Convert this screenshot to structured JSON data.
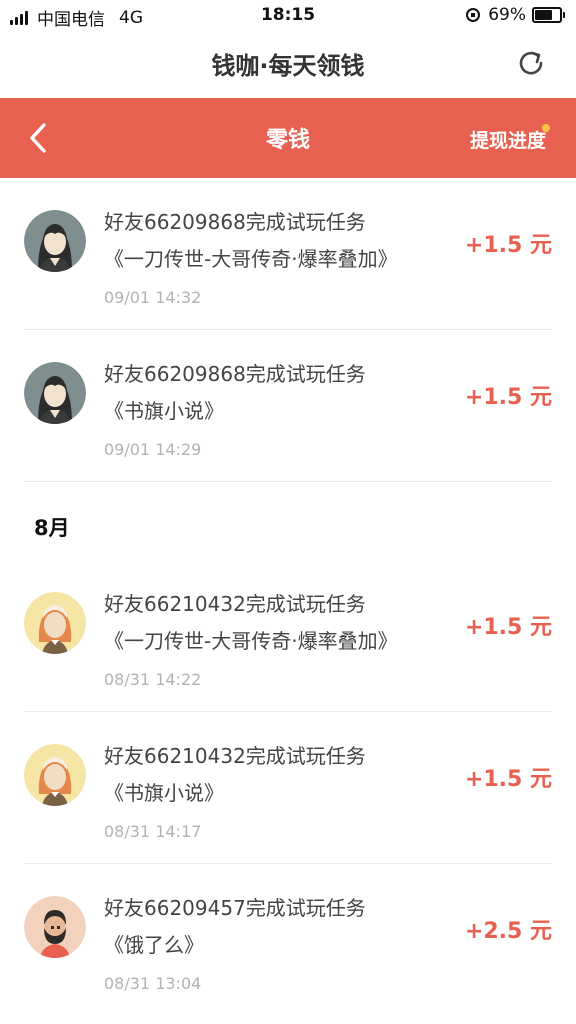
{
  "status_bar": {
    "carrier": "中国电信",
    "network": "4G",
    "time": "18:15",
    "battery": "69%",
    "battery_level": 0.69
  },
  "app": {
    "title": "钱咖·每天领钱"
  },
  "header": {
    "title": "零钱",
    "right_link": "提现进度",
    "color": "#e8604f"
  },
  "sections": [
    {
      "month": "",
      "items": [
        {
          "desc": "好友66209868完成试玩任务《一刀传世-大哥传奇·爆率叠加》",
          "time": "09/01 14:32",
          "amount": "+1.5 元",
          "avatar": "girl-dark-hair-avatar"
        },
        {
          "desc": "好友66209868完成试玩任务《书旗小说》",
          "time": "09/01 14:29",
          "amount": "+1.5 元",
          "avatar": "girl-dark-hair-avatar"
        }
      ]
    },
    {
      "month": "8月",
      "items": [
        {
          "desc": "好友66210432完成试玩任务《一刀传世-大哥传奇·爆率叠加》",
          "time": "08/31 14:22",
          "amount": "+1.5 元",
          "avatar": "girl-orange-hair-avatar"
        },
        {
          "desc": "好友66210432完成试玩任务《书旗小说》",
          "time": "08/31 14:17",
          "amount": "+1.5 元",
          "avatar": "girl-orange-hair-avatar"
        },
        {
          "desc": "好友66209457完成试玩任务《饿了么》",
          "time": "08/31 13:04",
          "amount": "+2.5 元",
          "avatar": "bearded-man-avatar"
        }
      ]
    }
  ]
}
